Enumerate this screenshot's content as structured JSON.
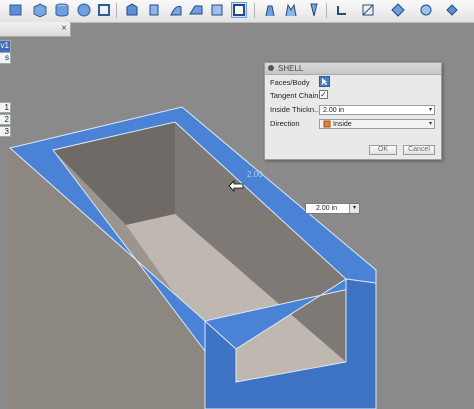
{
  "toolbar": {
    "icons": [
      "sketch-icon",
      "box-icon",
      "cylinder-icon",
      "sphere-icon",
      "pipe-icon",
      "extrude-icon",
      "revolve-icon",
      "sweep-icon",
      "loft-icon",
      "fillet-icon",
      "chamfer-icon",
      "shell-icon",
      "draft-icon",
      "scale-icon",
      "combine-icon",
      "joint-icon",
      "as-built-joint-icon",
      "rigid-group-icon",
      "motion-link-icon",
      "measure-icon",
      "inspect-icon",
      "insert-icon"
    ]
  },
  "browser": {
    "close_glyph": "×",
    "node_a": "v1",
    "node_b": "s",
    "node_c": "1",
    "node_d": "2",
    "node_e": "3"
  },
  "dialog": {
    "title": "SHELL",
    "faces_label": "Faces/Body",
    "tangent_label": "Tangent Chain",
    "tangent_checked": true,
    "thickness_label": "Inside Thickn...",
    "thickness_value": "2.00 in",
    "direction_label": "Direction",
    "direction_value": "Inside",
    "ok_label": "OK",
    "cancel_label": "Cancel"
  },
  "viewport": {
    "dimension_ghost": "2.00",
    "thickness_input": "2.00 in",
    "colors": {
      "selected_face": "#4a82d6",
      "body": "#8b8680",
      "background": "#8a8a8a"
    }
  }
}
